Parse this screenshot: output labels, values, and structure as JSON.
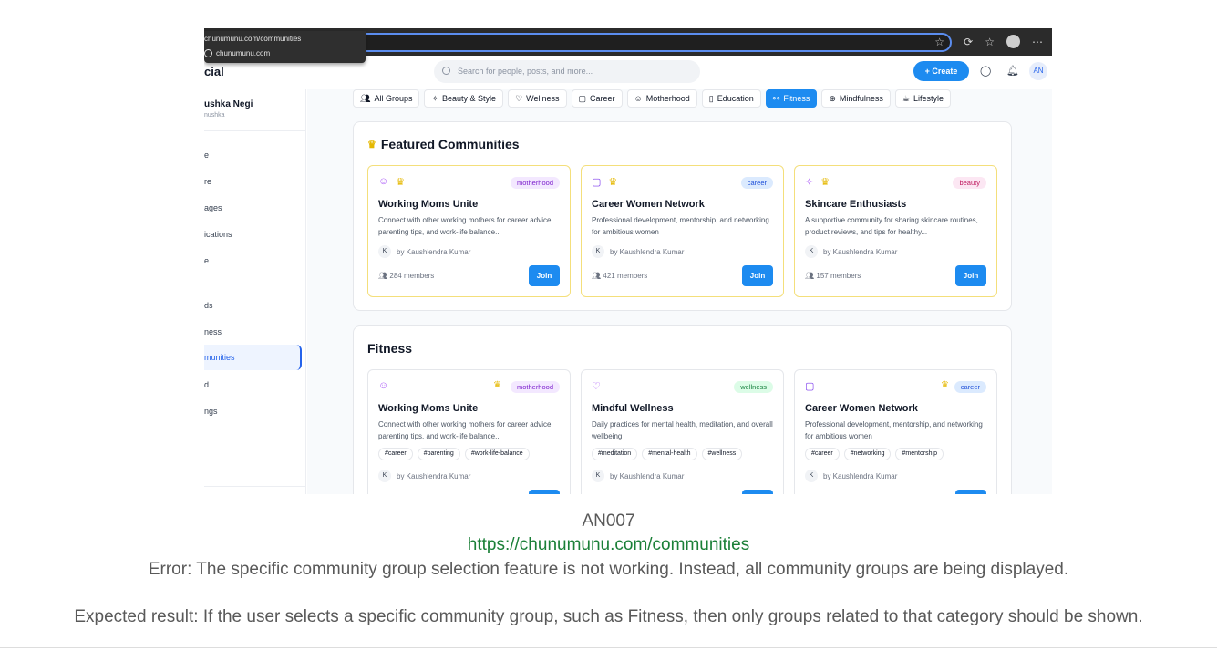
{
  "browser": {
    "tooltip_url": "chunumunu.com/communities",
    "tooltip_site": "chunumunu.com"
  },
  "app": {
    "logo_partial": "cial",
    "search_placeholder": "Search for people, posts, and more...",
    "create_label": "Create",
    "avatar_initials": "AN"
  },
  "sidebar": {
    "user_name": "ushka Negi",
    "user_handle": "nushka",
    "items": [
      "e",
      "re",
      "ages",
      "ications",
      "e",
      "ds",
      "ness",
      "munities",
      "d",
      "ngs"
    ],
    "active_index": 7
  },
  "categories": [
    {
      "icon": "users-icon",
      "label": "All Groups"
    },
    {
      "icon": "sparkles-icon",
      "label": "Beauty & Style"
    },
    {
      "icon": "heart-icon",
      "label": "Wellness"
    },
    {
      "icon": "briefcase-icon",
      "label": "Career"
    },
    {
      "icon": "baby-icon",
      "label": "Motherhood"
    },
    {
      "icon": "book-icon",
      "label": "Education"
    },
    {
      "icon": "dumbbell-icon",
      "label": "Fitness",
      "active": true
    },
    {
      "icon": "brain-icon",
      "label": "Mindfulness"
    },
    {
      "icon": "coffee-icon",
      "label": "Lifestyle"
    }
  ],
  "featured": {
    "title": "Featured Communities",
    "cards": [
      {
        "name": "Working Moms Unite",
        "tag": "motherhood",
        "desc": "Connect with other working mothers for career advice, parenting tips, and work-life balance...",
        "author_initial": "K",
        "author": "by Kaushlendra Kumar",
        "members": "284 members",
        "join": "Join"
      },
      {
        "name": "Career Women Network",
        "tag": "career",
        "desc": "Professional development, mentorship, and networking for ambitious women",
        "author_initial": "K",
        "author": "by Kaushlendra Kumar",
        "members": "421 members",
        "join": "Join"
      },
      {
        "name": "Skincare Enthusiasts",
        "tag": "beauty",
        "desc": "A supportive community for sharing skincare routines, product reviews, and tips for healthy...",
        "author_initial": "K",
        "author": "by Kaushlendra Kumar",
        "members": "157 members",
        "join": "Join"
      }
    ]
  },
  "fitness": {
    "title": "Fitness",
    "cards": [
      {
        "name": "Working Moms Unite",
        "tag": "motherhood",
        "desc": "Connect with other working mothers for career advice, parenting tips, and work-life balance...",
        "tags": [
          "#career",
          "#parenting",
          "#work-life-balance"
        ],
        "author_initial": "K",
        "author": "by Kaushlendra Kumar"
      },
      {
        "name": "Mindful Wellness",
        "tag": "wellness",
        "desc": "Daily practices for mental health, meditation, and overall wellbeing",
        "tags": [
          "#meditation",
          "#mental-health",
          "#wellness"
        ],
        "author_initial": "K",
        "author": "by Kaushlendra Kumar"
      },
      {
        "name": "Career Women Network",
        "tag": "career",
        "desc": "Professional development, mentorship, and networking for ambitious women",
        "tags": [
          "#career",
          "#networking",
          "#mentorship"
        ],
        "author_initial": "K",
        "author": "by Kaushlendra Kumar"
      }
    ]
  },
  "caption": {
    "id": "AN007",
    "url": "https://chunumunu.com/communities",
    "error": "Error: The specific community group selection feature is not working. Instead, all community groups are being displayed.",
    "expected": "Expected result: If the user selects a specific community group, such as Fitness, then only groups related to that category should be shown."
  }
}
